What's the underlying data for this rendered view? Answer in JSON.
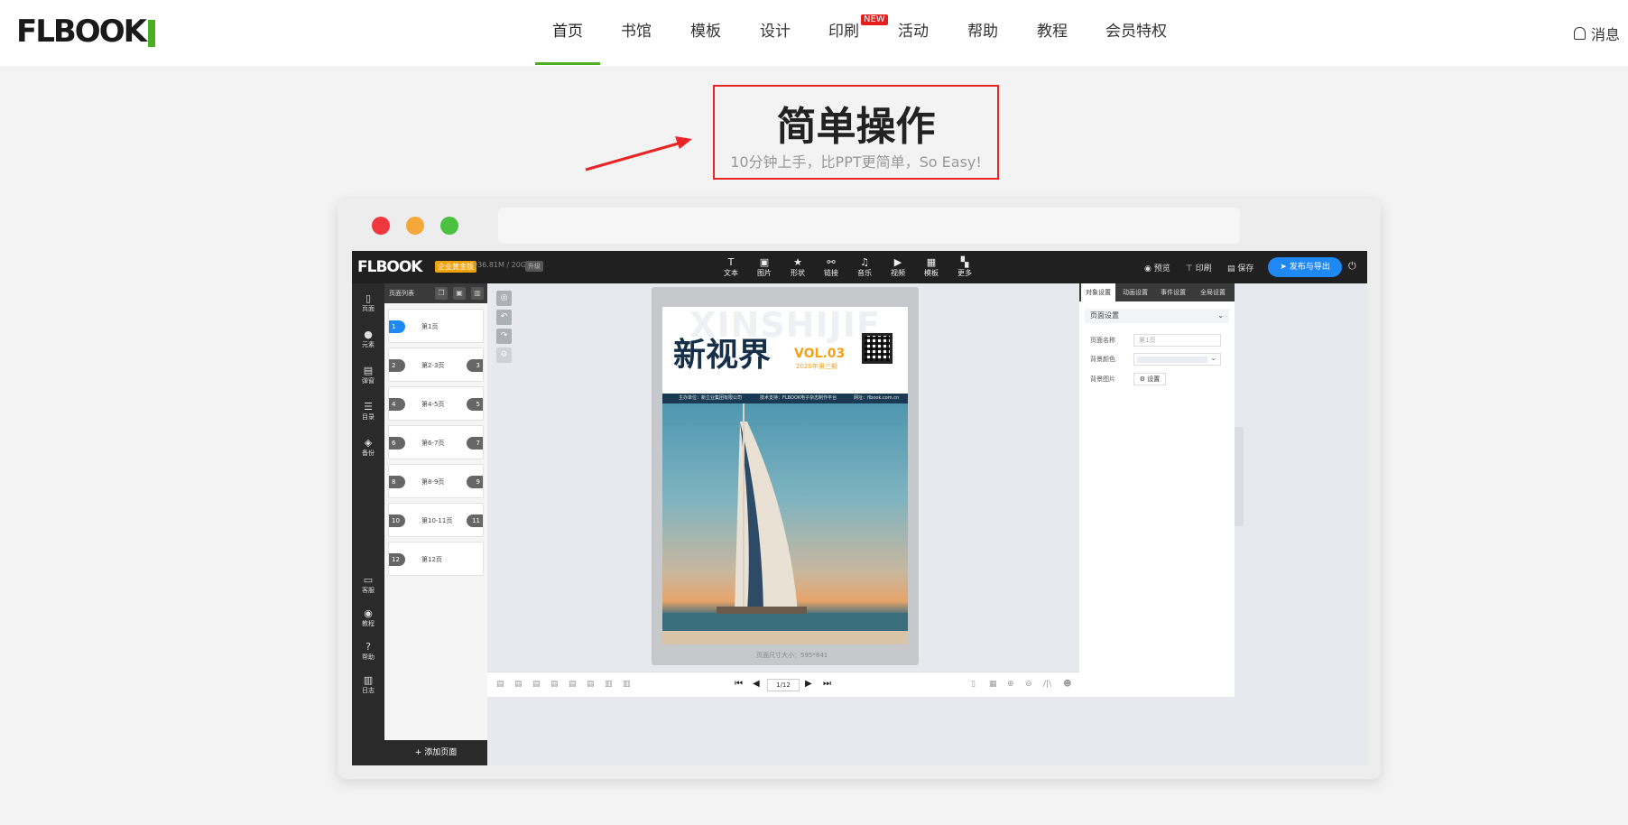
{
  "header": {
    "logo": "FLBOOK",
    "nav": [
      "首页",
      "书馆",
      "模板",
      "设计",
      "印刷",
      "活动",
      "帮助",
      "教程",
      "会员特权"
    ],
    "new_badge": "NEW",
    "messages": "消息"
  },
  "hero": {
    "title": "简单操作",
    "subtitle": "10分钟上手，比PPT更简单，So Easy!"
  },
  "app": {
    "logo": "FLBOOK",
    "edition": "企业黄金版",
    "storage": "936.81M / 20G",
    "upgrade": "升级",
    "tools": [
      {
        "label": "文本",
        "icon": "T"
      },
      {
        "label": "图片",
        "icon": "▣"
      },
      {
        "label": "形状",
        "icon": "★"
      },
      {
        "label": "链接",
        "icon": "⚯"
      },
      {
        "label": "音乐",
        "icon": "♫"
      },
      {
        "label": "视频",
        "icon": "▶"
      },
      {
        "label": "模板",
        "icon": "▦"
      },
      {
        "label": "更多",
        "icon": "▚"
      }
    ],
    "preview": "预览",
    "print": "印刷",
    "save": "保存",
    "publish": "发布与导出",
    "left_sidebar": [
      "页面",
      "元素",
      "弹窗",
      "目录",
      "备份",
      "客服",
      "教程",
      "帮助",
      "日志"
    ],
    "page_list_title": "页面列表",
    "pages": [
      {
        "l": "1",
        "label": "第1页",
        "r": ""
      },
      {
        "l": "2",
        "label": "第2-3页",
        "r": "3"
      },
      {
        "l": "4",
        "label": "第4-5页",
        "r": "5"
      },
      {
        "l": "6",
        "label": "第6-7页",
        "r": "7"
      },
      {
        "l": "8",
        "label": "第8-9页",
        "r": "9"
      },
      {
        "l": "10",
        "label": "第10-11页",
        "r": "11"
      },
      {
        "l": "12",
        "label": "第12页",
        "r": ""
      }
    ],
    "add_page": "+ 添加页面",
    "magazine": {
      "bg_word": "XINSHIJIE",
      "title": "新视界",
      "vol": "VOL.03",
      "issue": "2020年第三期",
      "info_left": "主办单位：新立业集团有限公司",
      "info_mid": "技术支持：FLBOOK电子杂志制作平台",
      "info_right": "网址：flbook.com.cn"
    },
    "page_size": "页面尺寸大小：595*841",
    "pager": "1/12",
    "right_panel": {
      "tabs": [
        "对象设置",
        "动画设置",
        "事件设置",
        "全局设置"
      ],
      "section": "页面设置",
      "name_label": "页面名称",
      "name_placeholder": "第1页",
      "bg_color_label": "背景颜色",
      "bg_image_label": "背景图片",
      "settings_btn": "⚙ 设置"
    }
  }
}
